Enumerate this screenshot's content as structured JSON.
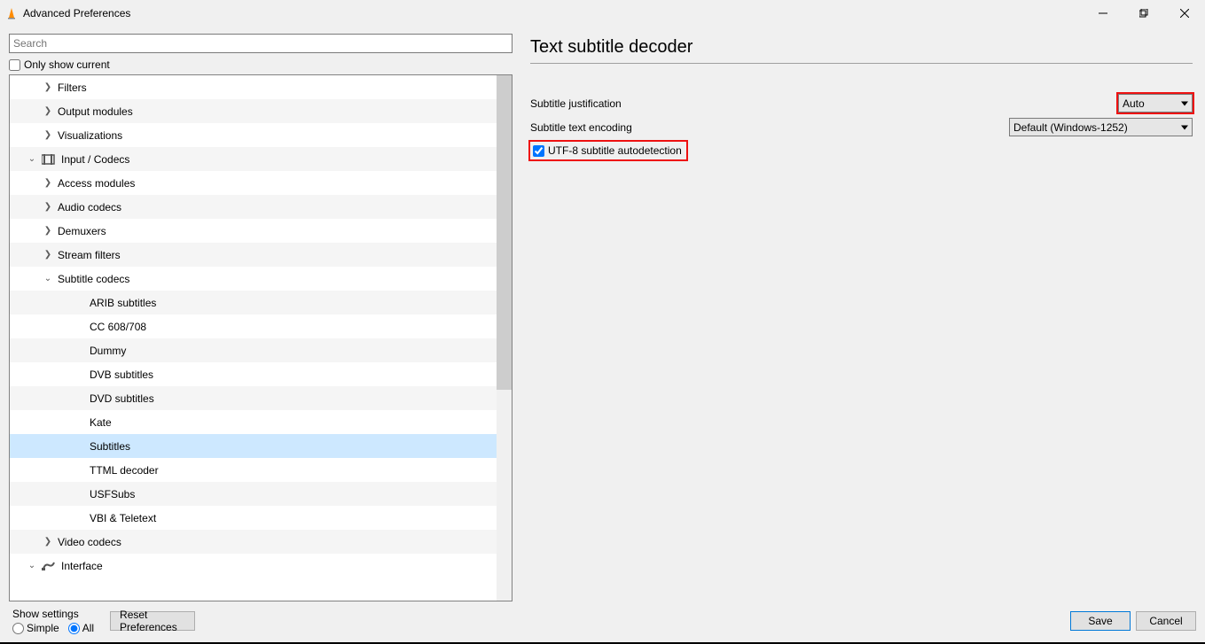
{
  "title": "Advanced Preferences",
  "search_placeholder": "Search",
  "only_show_current": "Only show current",
  "tree": {
    "filters": "Filters",
    "output_modules": "Output modules",
    "visualizations": "Visualizations",
    "input_codecs": "Input / Codecs",
    "access_modules": "Access modules",
    "audio_codecs": "Audio codecs",
    "demuxers": "Demuxers",
    "stream_filters": "Stream filters",
    "subtitle_codecs": "Subtitle codecs",
    "arib": "ARIB subtitles",
    "cc": "CC 608/708",
    "dummy": "Dummy",
    "dvb": "DVB subtitles",
    "dvd": "DVD subtitles",
    "kate": "Kate",
    "subtitles": "Subtitles",
    "ttml": "TTML decoder",
    "usf": "USFSubs",
    "vbi": "VBI & Teletext",
    "video_codecs": "Video codecs",
    "interface": "Interface"
  },
  "panel": {
    "title": "Text subtitle decoder",
    "justification_label": "Subtitle justification",
    "justification_value": "Auto",
    "encoding_label": "Subtitle text encoding",
    "encoding_value": "Default (Windows-1252)",
    "utf8_label": "UTF-8 subtitle autodetection"
  },
  "footer": {
    "show_settings": "Show settings",
    "simple": "Simple",
    "all": "All",
    "reset": "Reset Preferences",
    "save": "Save",
    "cancel": "Cancel"
  }
}
